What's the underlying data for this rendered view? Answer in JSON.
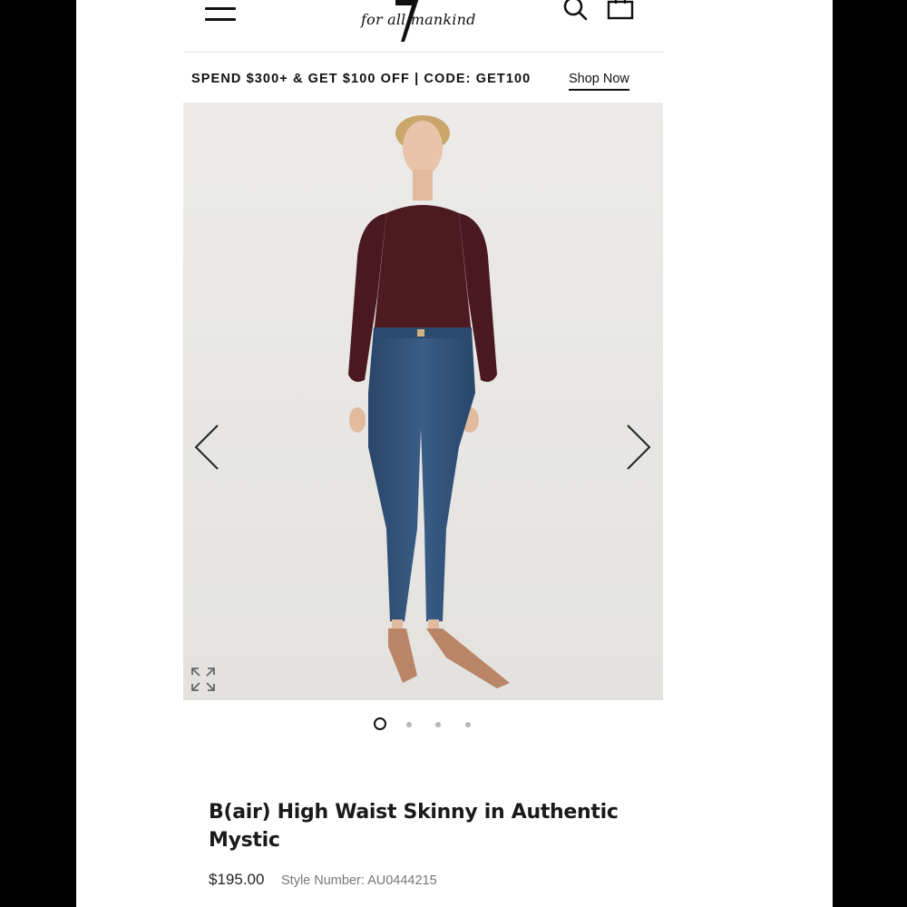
{
  "header": {
    "logo_text": "for all mankind",
    "menu_icon": "hamburger-menu-icon",
    "search_icon": "search-icon",
    "bag_icon": "shopping-bag-icon"
  },
  "promo": {
    "text": "SPEND $300+ & GET $100 OFF | CODE: GET100",
    "link_label": "Shop Now"
  },
  "gallery": {
    "image_alt": "Model wearing burgundy sweater and high waist skinny jeans",
    "prev_icon": "chevron-left-icon",
    "next_icon": "chevron-right-icon",
    "expand_icon": "expand-icon",
    "dots": [
      true,
      false,
      false,
      false
    ]
  },
  "product": {
    "title": "B(air) High Waist Skinny in Authentic Mystic",
    "price": "$195.00",
    "style_number": "Style Number: AU0444215"
  },
  "colors": {
    "sweater": "#4e1a22",
    "denim": "#2f4f74",
    "background": "#e8e8e6"
  }
}
